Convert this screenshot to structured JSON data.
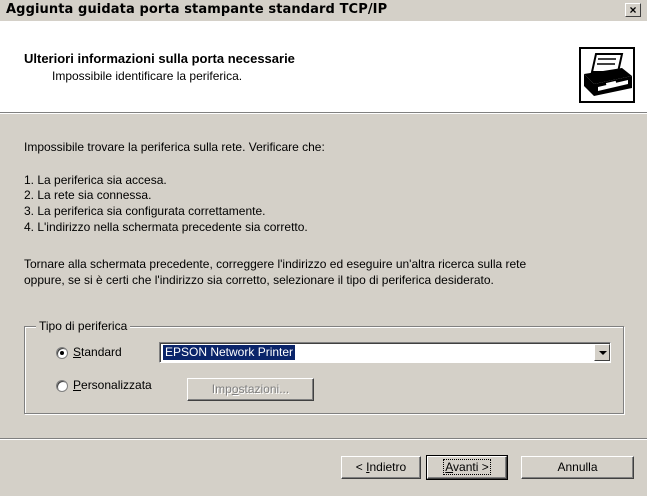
{
  "window": {
    "title": "Aggiunta guidata porta stampante standard TCP/IP",
    "close_label": "×"
  },
  "header": {
    "title": "Ulteriori informazioni sulla porta necessarie",
    "subtitle": "Impossibile identificare la periferica."
  },
  "body": {
    "intro": "Impossibile trovare la periferica sulla rete. Verificare che:",
    "checks": [
      "1. La periferica sia accesa.",
      "2. La rete sia connessa.",
      "3. La periferica sia configurata correttamente.",
      "4. L'indirizzo nella schermata precedente sia corretto."
    ],
    "instruction_line1": "Tornare alla schermata precedente, correggere l'indirizzo ed eseguire un'altra ricerca sulla rete",
    "instruction_line2": "oppure, se si è certi che l'indirizzo sia corretto, selezionare il tipo di periferica desiderato."
  },
  "device_type": {
    "group_label": "Tipo di periferica",
    "standard": {
      "accel": "S",
      "rest": "tandard",
      "selected": true
    },
    "custom": {
      "accel": "P",
      "rest": "ersonalizzata",
      "selected": false
    },
    "standard_select_value": "EPSON Network Printer",
    "settings_button": {
      "pre": "Imp",
      "accel": "o",
      "post": "stazioni...",
      "enabled": false
    }
  },
  "footer": {
    "back": {
      "pre": "< ",
      "accel": "I",
      "post": "ndietro"
    },
    "next": {
      "accel": "A",
      "post": "vanti >"
    },
    "cancel": "Annulla"
  },
  "colors": {
    "face": "#d4d0c8",
    "selection": "#0a246a",
    "header_bg": "#ffffff"
  },
  "icons": {
    "header": "printer-network-icon",
    "combo": "chevron-down-icon"
  }
}
